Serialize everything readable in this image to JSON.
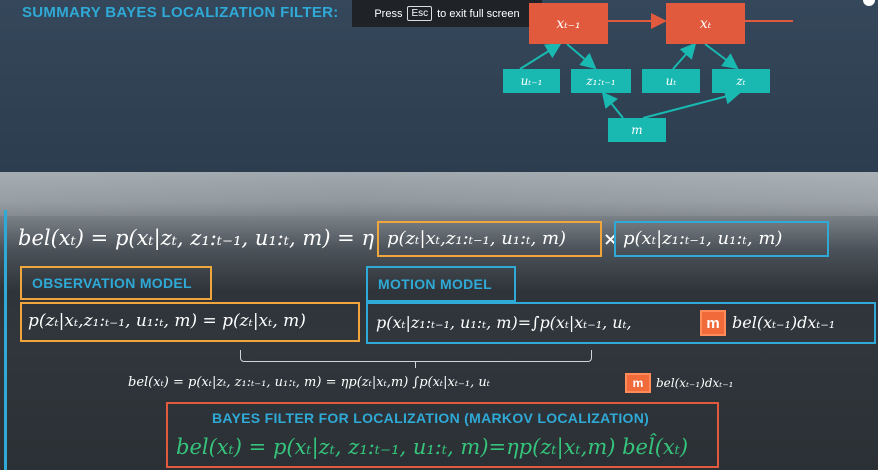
{
  "header": {
    "title": "SUMMARY BAYES LOCALIZATION FILTER:"
  },
  "fullscreen_notice": {
    "prefix": "Press",
    "key": "Esc",
    "suffix": "to exit full screen"
  },
  "diagram": {
    "nodes": {
      "x_prev": "xₜ₋₁",
      "x_t": "xₜ",
      "u_prev": "uₜ₋₁",
      "z_range": "z₁:ₜ₋₁",
      "u_t": "uₜ",
      "z_t": "zₜ",
      "m": "m"
    }
  },
  "equations": {
    "main_lhs": "bel(xₜ) = p(xₜ|zₜ, z₁:ₜ₋₁, u₁:ₜ, m) = η",
    "main_obs": "p(zₜ|xₜ,z₁:ₜ₋₁, u₁:ₜ, m)",
    "main_times": "×",
    "main_motion": "p(xₜ|z₁:ₜ₋₁, u₁:ₜ, m)",
    "observation_eq": "p(zₜ|xₜ,z₁:ₜ₋₁, u₁:ₜ, m) = p(zₜ|xₜ, m)",
    "motion_eq_left": "p(xₜ|z₁:ₜ₋₁, u₁:ₜ, m)=∫p(xₜ|xₜ₋₁, uₜ,",
    "motion_eq_right": "bel(xₜ₋₁)dxₜ₋₁",
    "combined_left": "bel(xₜ) = p(xₜ|zₜ, z₁:ₜ₋₁, u₁:ₜ, m) = ηp(zₜ|xₜ,m) ∫p(xₜ|xₜ₋₁, uₜ",
    "combined_right": "bel(xₜ₋₁)dxₜ₋₁",
    "markov_eq": "bel(xₜ) = p(xₜ|zₜ, z₁:ₜ₋₁, u₁:ₜ, m)=ηp(zₜ|xₜ,m) bel̂(xₜ)",
    "crossed_m": "m"
  },
  "labels": {
    "observation_model": "OBSERVATION MODEL",
    "motion_model": "MOTION MODEL",
    "bayes_filter": "BAYES FILTER FOR LOCALIZATION (MARKOV LOCALIZATION)"
  },
  "colors": {
    "title_blue": "#2fa9d6",
    "node_red": "#e25a3e",
    "node_teal": "#19b9b2",
    "observation_orange": "#f0a63a",
    "motion_blue": "#2fa9d6",
    "markov_red": "#e25a3e",
    "markov_green": "#35c47c"
  }
}
